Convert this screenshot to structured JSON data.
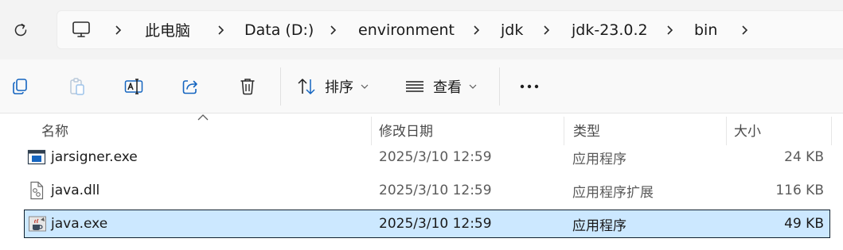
{
  "address_bar": {
    "crumbs": [
      "此电脑",
      "Data (D:)",
      "environment",
      "jdk",
      "jdk-23.0.2",
      "bin"
    ]
  },
  "toolbar": {
    "sort_label": "排序",
    "view_label": "查看"
  },
  "columns": {
    "name": "名称",
    "modified": "修改日期",
    "type": "类型",
    "size": "大小"
  },
  "files": [
    {
      "name": "jarsigner.exe",
      "modified": "2025/3/10 12:59",
      "type": "应用程序",
      "size": "24 KB",
      "icon": "exe-window-icon",
      "selected": false
    },
    {
      "name": "java.dll",
      "modified": "2025/3/10 12:59",
      "type": "应用程序扩展",
      "size": "116 KB",
      "icon": "dll-gear-file-icon",
      "selected": false
    },
    {
      "name": "java.exe",
      "modified": "2025/3/10 12:59",
      "type": "应用程序",
      "size": "49 KB",
      "icon": "java-cup-icon",
      "selected": true
    }
  ],
  "colors": {
    "selection_bg": "#cce8ff",
    "selection_border": "#0f1f2e",
    "accent_icon": "#1565c0"
  }
}
